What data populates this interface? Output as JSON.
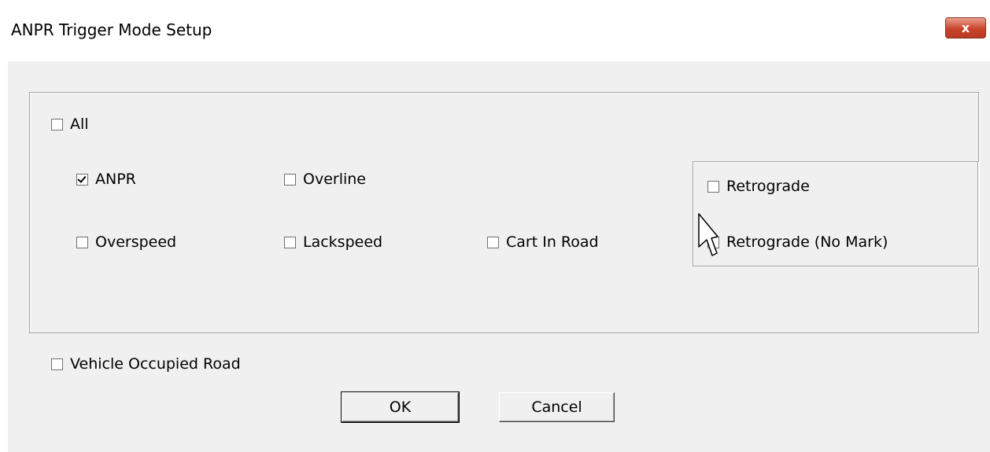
{
  "window": {
    "title": "ANPR Trigger Mode Setup",
    "close_label": "x"
  },
  "options": {
    "all": {
      "label": "All",
      "checked": false
    },
    "anpr": {
      "label": "ANPR",
      "checked": true
    },
    "overline": {
      "label": "Overline",
      "checked": false
    },
    "overspeed": {
      "label": "Overspeed",
      "checked": false
    },
    "lackspeed": {
      "label": "Lackspeed",
      "checked": false
    },
    "cart_in_road": {
      "label": "Cart In Road",
      "checked": false
    },
    "retrograde": {
      "label": "Retrograde",
      "checked": false
    },
    "retrograde_no_mark": {
      "label": "Retrograde (No Mark)",
      "checked": false
    },
    "vehicle_occupied_road": {
      "label": "Vehicle Occupied Road",
      "checked": false
    }
  },
  "buttons": {
    "ok_label": "OK",
    "cancel_label": "Cancel"
  },
  "icons": {
    "close": "close-icon",
    "cursor": "mouse-pointer-icon"
  },
  "colors": {
    "dialog_background": "#f0f0f0",
    "close_button": "#c9432b"
  }
}
